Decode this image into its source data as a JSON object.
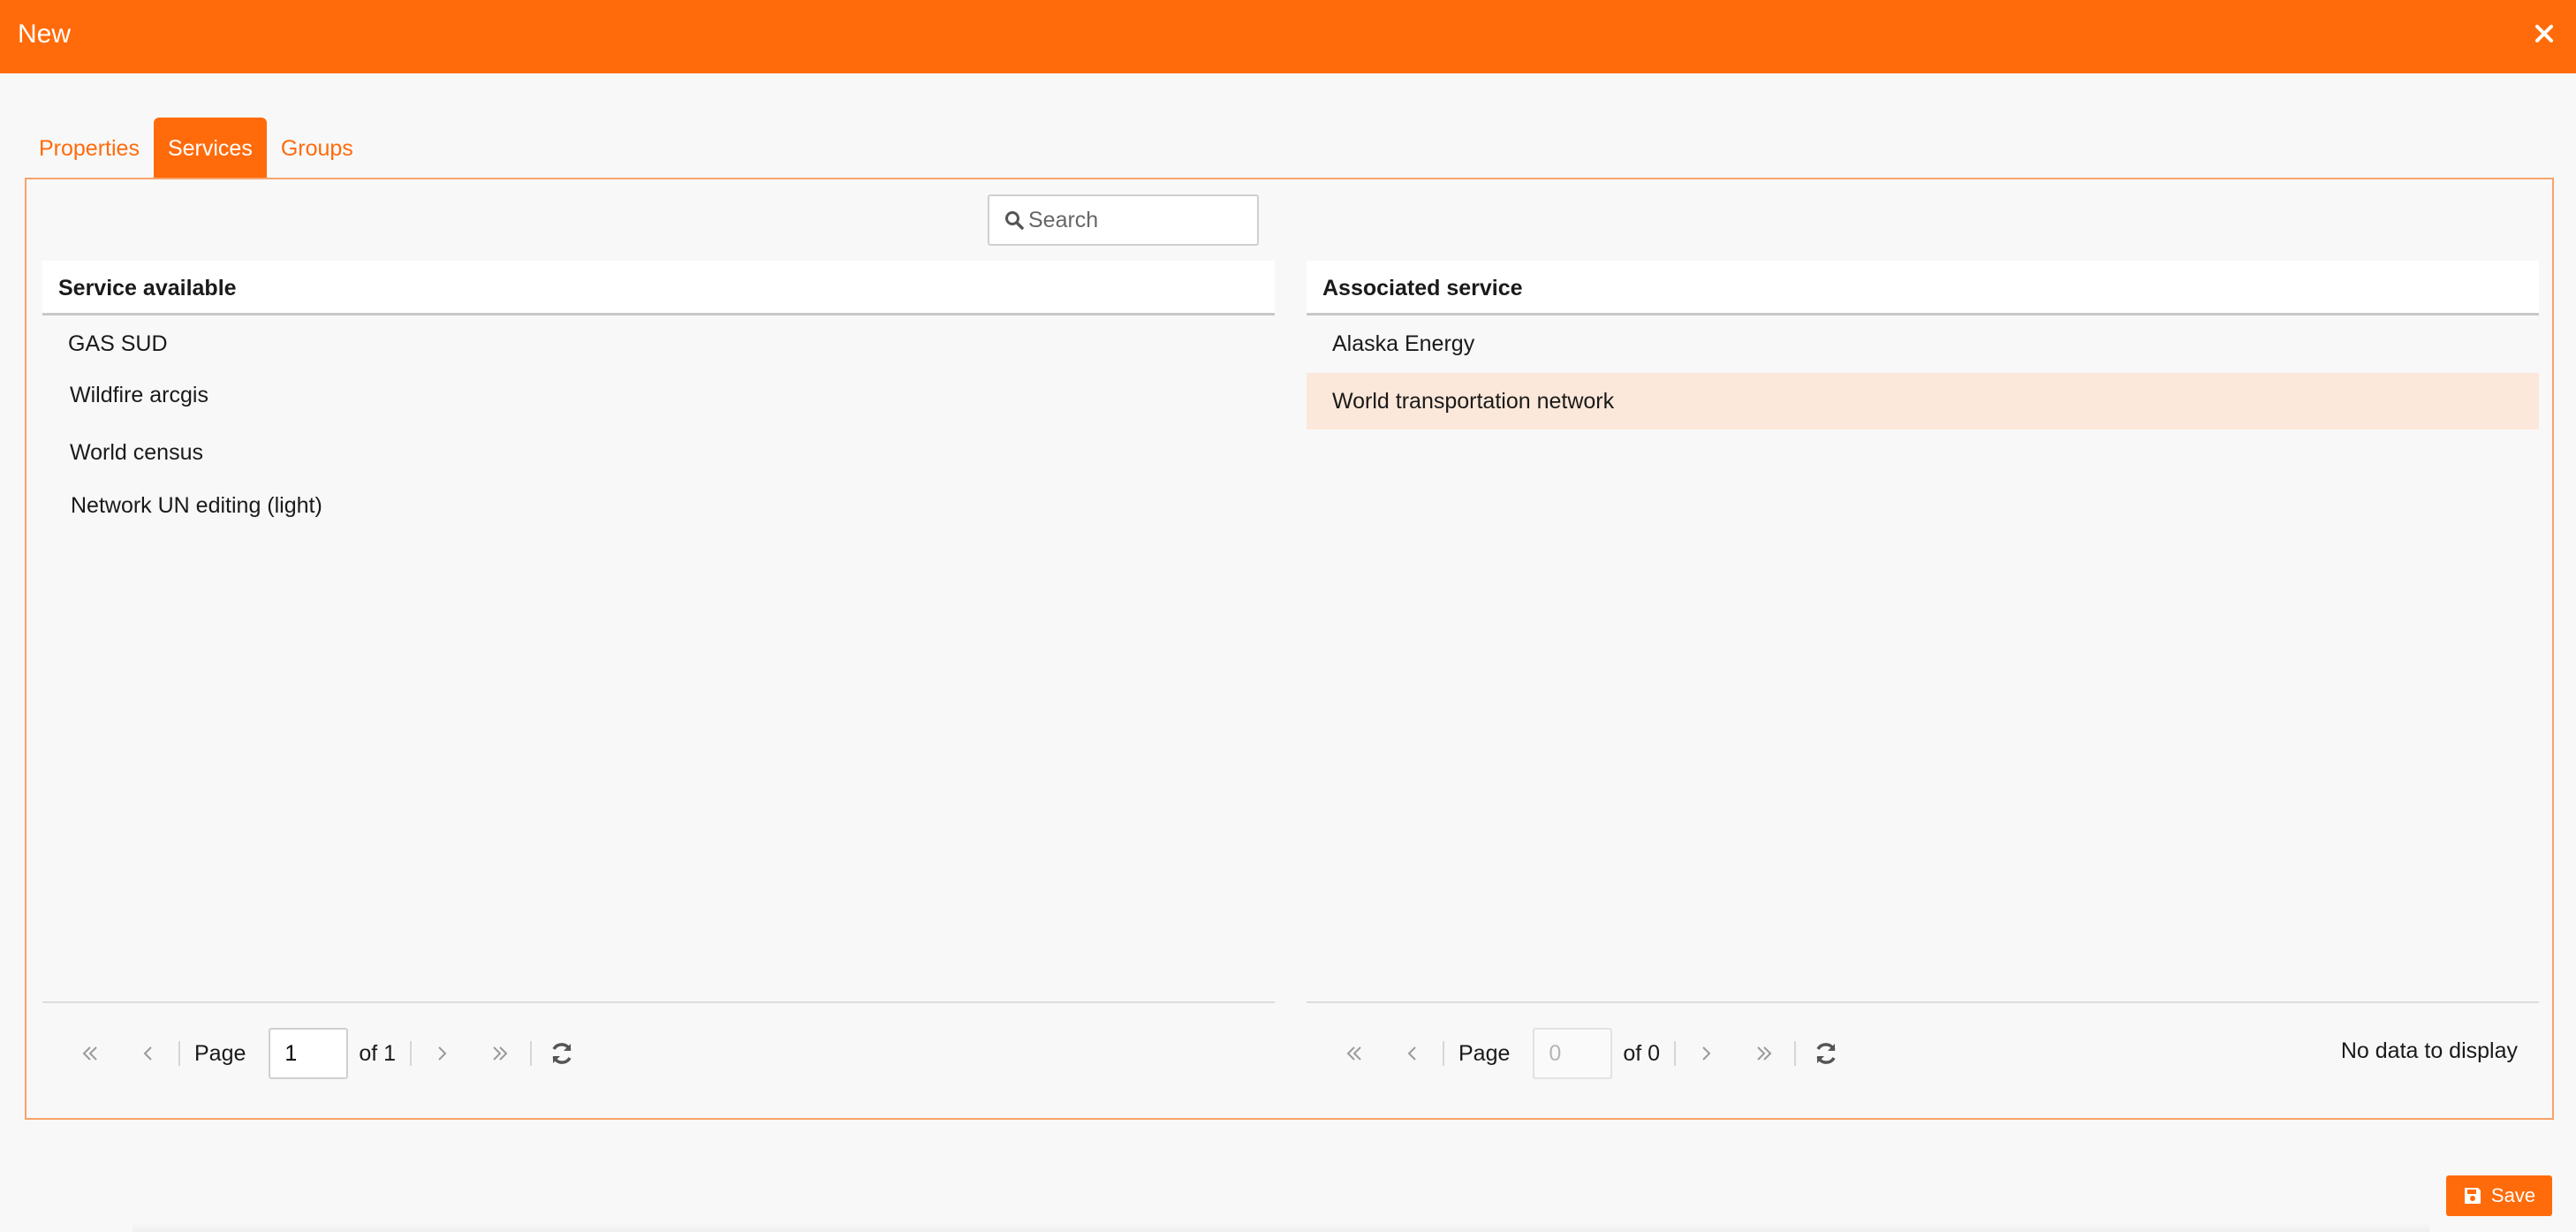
{
  "window": {
    "title": "New"
  },
  "tabs": [
    {
      "label": "Properties",
      "active": false
    },
    {
      "label": "Services",
      "active": true
    },
    {
      "label": "Groups",
      "active": false
    }
  ],
  "search": {
    "placeholder": "Search",
    "value": ""
  },
  "available": {
    "header": "Service available",
    "rows": [
      "GAS SUD",
      "Wildfire arcgis",
      "World census",
      "Network UN editing (light)"
    ],
    "pager": {
      "page_label": "Page",
      "page_value": "1",
      "of_label": "of 1"
    }
  },
  "associated": {
    "header": "Associated service",
    "rows": [
      "Alaska Energy",
      "World transportation network"
    ],
    "selected_index": 1,
    "pager": {
      "page_label": "Page",
      "page_value": "0",
      "of_label": "of 0"
    },
    "status": "No data to display"
  },
  "actions": {
    "save_label": "Save"
  },
  "colors": {
    "accent": "#ff6b0a",
    "selected_row": "#fce8da",
    "panel_border": "#f9a36a"
  },
  "icons": [
    "close-icon",
    "search-icon",
    "first-page-icon",
    "prev-page-icon",
    "next-page-icon",
    "last-page-icon",
    "refresh-icon",
    "save-icon"
  ]
}
